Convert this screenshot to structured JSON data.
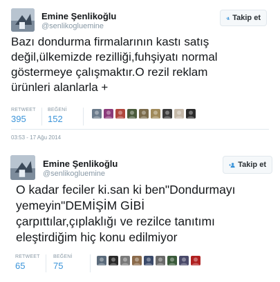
{
  "tweets": [
    {
      "author": {
        "name": "Emine Şenlikoğlu",
        "handle": "@senlikogluemine"
      },
      "follow_label": "Takip et",
      "text_lines": [
        "Bazı dondurma firmalarının kastı satış",
        "değil,ülkemizde rezilliği,fuhşiyatı normal",
        "göstermeye çalışmaktır.O rezil reklam",
        "ürünleri alanlarla +"
      ],
      "stats": {
        "retweet_label": "RETWEET",
        "retweet_count": "395",
        "like_label": "BEĞENİ",
        "like_count": "152"
      },
      "liker_avatars": [
        {
          "icon": "user-avatar-icon",
          "color": "#6a7a8a"
        },
        {
          "icon": "user-avatar-icon",
          "color": "#8b3a7a"
        },
        {
          "icon": "user-avatar-icon",
          "color": "#b0463c"
        },
        {
          "icon": "user-avatar-icon",
          "color": "#4a5a3a"
        },
        {
          "icon": "user-avatar-icon",
          "color": "#7a6a4a"
        },
        {
          "icon": "user-avatar-icon",
          "color": "#a08a5a"
        },
        {
          "icon": "user-avatar-icon",
          "color": "#3a3a3a"
        },
        {
          "icon": "user-avatar-icon",
          "color": "#c4b8a8"
        },
        {
          "icon": "user-avatar-icon",
          "color": "#2a2a2a"
        }
      ],
      "timestamp": "03:53 - 17 Ağu 2014"
    },
    {
      "author": {
        "name": "Emine Şenlikoğlu",
        "handle": "@senlikogluemine"
      },
      "follow_label": "Takip et",
      "text_lines": [
        "O kadar feciler ki.san ki ben\"Dondurmayı",
        "yemeyin\"DEMİŞİM GİBİ",
        "çarpıttılar,çıplaklığı ve rezilce tanıtımı",
        "eleştirdiğim hiç konu edilmiyor"
      ],
      "stats": {
        "retweet_label": "RETWEET",
        "retweet_count": "65",
        "like_label": "BEĞENİ",
        "like_count": "75"
      },
      "liker_avatars": [
        {
          "icon": "user-avatar-icon",
          "color": "#5a6a7a"
        },
        {
          "icon": "user-avatar-icon",
          "color": "#2a2a2a"
        },
        {
          "icon": "user-avatar-icon",
          "color": "#7a7a7a"
        },
        {
          "icon": "user-avatar-icon",
          "color": "#8a6a4a"
        },
        {
          "icon": "user-avatar-icon",
          "color": "#3a4a6a"
        },
        {
          "icon": "user-avatar-icon",
          "color": "#6a6a6a"
        },
        {
          "icon": "user-avatar-icon",
          "color": "#3a5a3a"
        },
        {
          "icon": "user-avatar-icon",
          "color": "#4a4a6a"
        },
        {
          "icon": "user-avatar-icon",
          "color": "#b02020"
        }
      ]
    }
  ],
  "colors": {
    "link_blue": "#3b94d9",
    "muted": "#8899a6",
    "border": "#e1e8ed"
  }
}
